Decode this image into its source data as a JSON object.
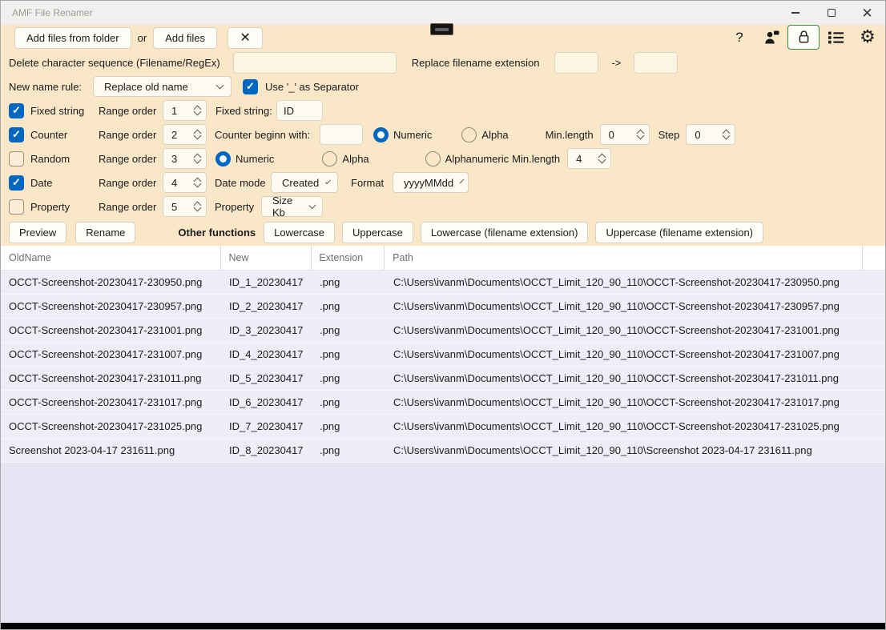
{
  "window": {
    "title": "AMF File Renamer"
  },
  "toolbar": {
    "add_from_folder": "Add files from folder",
    "or_label": "or",
    "add_files": "Add files"
  },
  "delete_row": {
    "label": "Delete character sequence (Filename/RegEx)",
    "value": ""
  },
  "replace_ext": {
    "label": "Replace filename extension",
    "from": "",
    "arrow": "->",
    "to": ""
  },
  "name_rule": {
    "label": "New name rule:",
    "selected": "Replace old name",
    "separator_label": "Use '_' as Separator"
  },
  "rules": {
    "range_order_label": "Range order",
    "fixed": {
      "label": "Fixed string",
      "order": "1",
      "field_label": "Fixed string:",
      "value": "ID"
    },
    "counter": {
      "label": "Counter",
      "order": "2",
      "begin_label": "Counter beginn with:",
      "begin_value": "",
      "numeric_label": "Numeric",
      "alpha_label": "Alpha",
      "minlength_label": "Min.length",
      "minlength": "0",
      "step_label": "Step",
      "step": "0"
    },
    "random": {
      "label": "Random",
      "order": "3",
      "numeric_label": "Numeric",
      "alpha_label": "Alpha",
      "alphanumeric_label": "Alphanumeric",
      "minlength_label": "Min.length",
      "minlength": "4"
    },
    "date": {
      "label": "Date",
      "order": "4",
      "mode_label": "Date mode",
      "mode": "Created",
      "format_label": "Format",
      "format": "yyyyMMdd"
    },
    "property": {
      "label": "Property",
      "order": "5",
      "prop_label": "Property",
      "prop": "Size Kb"
    }
  },
  "actions": {
    "preview": "Preview",
    "rename": "Rename",
    "other_label": "Other functions",
    "lowercase": "Lowercase",
    "uppercase": "Uppercase",
    "lowercase_ext": "Lowercase (filename extension)",
    "uppercase_ext": "Uppercase (filename extension)"
  },
  "table": {
    "columns": [
      "OldName",
      "New",
      "Extension",
      "Path"
    ],
    "rows": [
      [
        "OCCT-Screenshot-20230417-230950.png",
        "ID_1_20230417",
        ".png",
        "C:\\Users\\ivanm\\Documents\\OCCT_Limit_120_90_110\\OCCT-Screenshot-20230417-230950.png"
      ],
      [
        "OCCT-Screenshot-20230417-230957.png",
        "ID_2_20230417",
        ".png",
        "C:\\Users\\ivanm\\Documents\\OCCT_Limit_120_90_110\\OCCT-Screenshot-20230417-230957.png"
      ],
      [
        "OCCT-Screenshot-20230417-231001.png",
        "ID_3_20230417",
        ".png",
        "C:\\Users\\ivanm\\Documents\\OCCT_Limit_120_90_110\\OCCT-Screenshot-20230417-231001.png"
      ],
      [
        "OCCT-Screenshot-20230417-231007.png",
        "ID_4_20230417",
        ".png",
        "C:\\Users\\ivanm\\Documents\\OCCT_Limit_120_90_110\\OCCT-Screenshot-20230417-231007.png"
      ],
      [
        "OCCT-Screenshot-20230417-231011.png",
        "ID_5_20230417",
        ".png",
        "C:\\Users\\ivanm\\Documents\\OCCT_Limit_120_90_110\\OCCT-Screenshot-20230417-231011.png"
      ],
      [
        "OCCT-Screenshot-20230417-231017.png",
        "ID_6_20230417",
        ".png",
        "C:\\Users\\ivanm\\Documents\\OCCT_Limit_120_90_110\\OCCT-Screenshot-20230417-231017.png"
      ],
      [
        "OCCT-Screenshot-20230417-231025.png",
        "ID_7_20230417",
        ".png",
        "C:\\Users\\ivanm\\Documents\\OCCT_Limit_120_90_110\\OCCT-Screenshot-20230417-231025.png"
      ],
      [
        "Screenshot 2023-04-17 231611.png",
        "ID_8_20230417",
        ".png",
        "C:\\Users\\ivanm\\Documents\\OCCT_Limit_120_90_110\\Screenshot 2023-04-17 231611.png"
      ]
    ]
  },
  "colors": {
    "panel": "#fae7c7",
    "accent_blue": "#0067c0",
    "selected_border_green": "#3d8a3d",
    "row_bg": "#eeeef8"
  }
}
